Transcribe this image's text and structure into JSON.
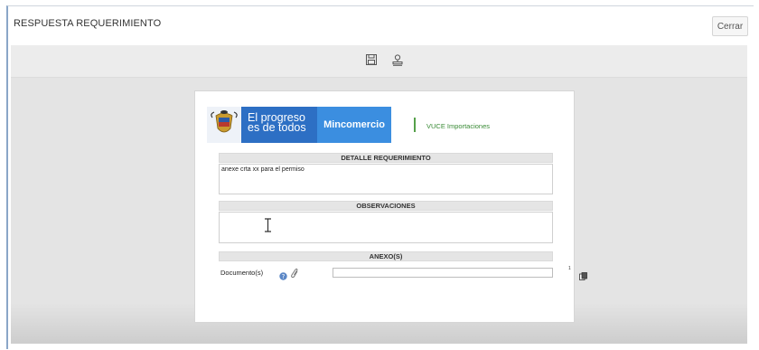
{
  "window": {
    "title": "RESPUESTA REQUERIMIENTO",
    "close_label": "Cerrar"
  },
  "toolbar": {
    "icons": [
      "save-icon",
      "stamp-icon"
    ]
  },
  "header": {
    "slogan_line1": "El progreso",
    "slogan_line2": "es de todos",
    "ministry": "Mincomercio",
    "system": "VUCE Importaciones"
  },
  "sections": {
    "detalle_title": "DETALLE REQUERIMIENTO",
    "detalle_text": "anexe crta xx para el permiso",
    "observaciones_title": "OBSERVACIONES",
    "observaciones_text": "",
    "anexos_title": "ANEXO(S)"
  },
  "attachments": {
    "label": "Documento(s)",
    "file_value": "",
    "count": "1"
  },
  "colors": {
    "brand_dark_blue": "#2d6fc4",
    "brand_blue": "#3b8ee0",
    "vuce_green": "#3a8b36"
  }
}
